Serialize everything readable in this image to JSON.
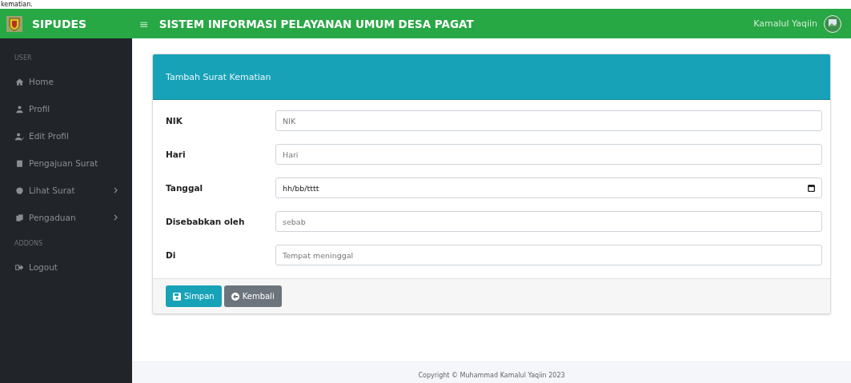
{
  "page_heading": "kematian.",
  "navbar": {
    "brand": "SIPUDES",
    "menu_icon": "≡",
    "title": "SISTEM INFORMASI PELAYANAN UMUM DESA PAGAT",
    "user": "Kamalul Yaqiin"
  },
  "sidebar": {
    "sections": [
      {
        "heading": "USER",
        "items": [
          {
            "label": "Home",
            "has_submenu": false
          },
          {
            "label": "Profil",
            "has_submenu": false
          },
          {
            "label": "Edit Profil",
            "has_submenu": false
          },
          {
            "label": "Pengajuan Surat",
            "has_submenu": false
          },
          {
            "label": "Lihat Surat",
            "has_submenu": true
          },
          {
            "label": "Pengaduan",
            "has_submenu": true
          }
        ]
      },
      {
        "heading": "ADDONS",
        "items": [
          {
            "label": "Logout",
            "has_submenu": false
          }
        ]
      }
    ]
  },
  "card": {
    "title": "Tambah Surat Kematian",
    "fields": [
      {
        "label": "NIK",
        "kind": "text",
        "placeholder": "NIK"
      },
      {
        "label": "Hari",
        "kind": "text",
        "placeholder": "Hari"
      },
      {
        "label": "Tanggal",
        "kind": "date",
        "value": "hh/bb/tttt"
      },
      {
        "label": "Disebabkan oleh",
        "kind": "text",
        "placeholder": "sebab"
      },
      {
        "label": "Di",
        "kind": "text",
        "placeholder": "Tempat meninggal"
      }
    ],
    "buttons": [
      {
        "label": "Simpan",
        "kind": "save"
      },
      {
        "label": "Kembali",
        "kind": "back"
      }
    ]
  },
  "footer": {
    "text": "Copyright © Muhammad Kamalul Yaqiin 2023"
  }
}
